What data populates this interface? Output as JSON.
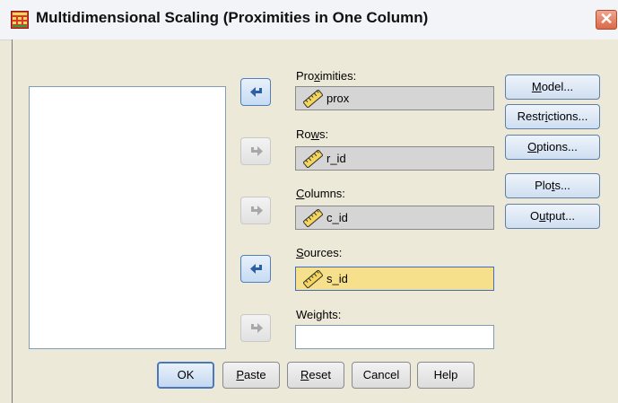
{
  "window": {
    "title": "Multidimensional Scaling (Proximities in One Column)"
  },
  "icons": {
    "app": "grid-table-icon",
    "close": "close-icon",
    "move_in": "arrow-move-in-icon",
    "move_out": "arrow-move-out-icon",
    "variable": "ruler-scale-icon"
  },
  "colors": {
    "selected_field": "#f6e08c",
    "filled_field": "#d5d5d5",
    "accent": "#4f7fbf"
  },
  "fields": {
    "proximities": {
      "label_before": "Pro",
      "label_key": "x",
      "label_after": "imities:",
      "value": "prox"
    },
    "rows": {
      "label_before": "Ro",
      "label_key": "w",
      "label_after": "s:",
      "value": "r_id"
    },
    "columns": {
      "label_before": "",
      "label_key": "C",
      "label_after": "olumns:",
      "value": "c_id"
    },
    "sources": {
      "label_before": "",
      "label_key": "S",
      "label_after": "ources:",
      "value": "s_id"
    },
    "weights": {
      "label_before": "Wei",
      "label_key": "g",
      "label_after": "hts:",
      "value": ""
    }
  },
  "side_buttons": {
    "model": {
      "before": "",
      "key": "M",
      "after": "odel..."
    },
    "restrictions": {
      "before": "Restr",
      "key": "i",
      "after": "ctions..."
    },
    "options": {
      "before": "",
      "key": "O",
      "after": "ptions..."
    },
    "plots": {
      "before": "Plo",
      "key": "t",
      "after": "s..."
    },
    "output": {
      "before": "O",
      "key": "u",
      "after": "tput..."
    }
  },
  "bottom_buttons": {
    "ok": {
      "before": "OK",
      "key": "",
      "after": ""
    },
    "paste": {
      "before": "",
      "key": "P",
      "after": "aste"
    },
    "reset": {
      "before": "",
      "key": "R",
      "after": "eset"
    },
    "cancel": {
      "before": "Cancel",
      "key": "",
      "after": ""
    },
    "help": {
      "before": "Help",
      "key": "",
      "after": ""
    }
  }
}
